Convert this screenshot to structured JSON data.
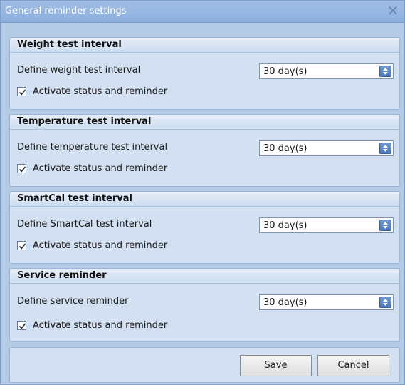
{
  "window": {
    "title": "General reminder settings"
  },
  "groups": [
    {
      "title": "Weight test interval",
      "label": "Define weight test interval",
      "value": "30 day(s)",
      "checkbox_label": "Activate status and reminder",
      "checked": true
    },
    {
      "title": "Temperature test interval",
      "label": "Define temperature test interval",
      "value": "30 day(s)",
      "checkbox_label": "Activate status and reminder",
      "checked": true
    },
    {
      "title": "SmartCal test interval",
      "label": "Define SmartCal test interval",
      "value": "30 day(s)",
      "checkbox_label": "Activate status and reminder",
      "checked": true
    },
    {
      "title": "Service reminder",
      "label": "Define service reminder",
      "value": "30 day(s)",
      "checkbox_label": "Activate status and reminder",
      "checked": true
    }
  ],
  "footer": {
    "save_label": "Save",
    "cancel_label": "Cancel"
  }
}
